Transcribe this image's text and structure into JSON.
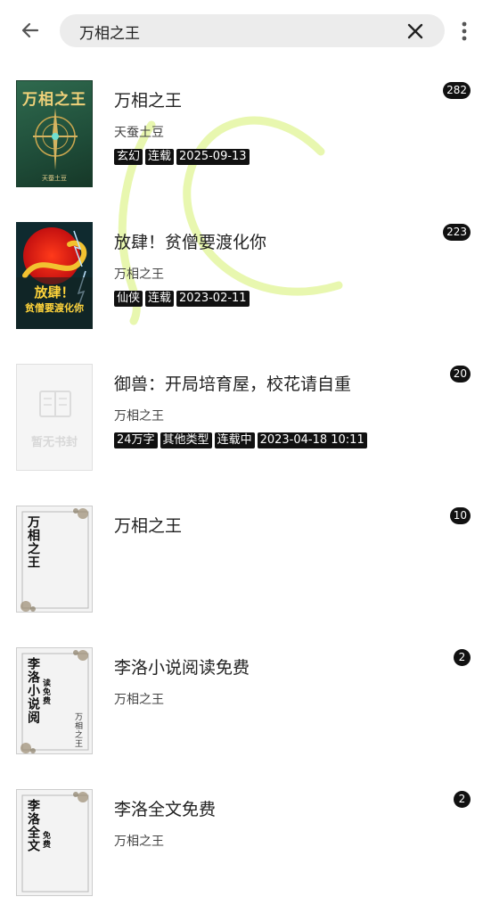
{
  "search": {
    "query": "万相之王"
  },
  "icons": {
    "back": "arrow-left-icon",
    "clear": "close-icon",
    "more": "more-vert-icon"
  },
  "books": [
    {
      "title": "万相之王",
      "author": "天蚕土豆",
      "tags": [
        "玄幻",
        "连载",
        "2025-09-13"
      ],
      "badge": "282",
      "cover": {
        "type": "green",
        "title": "万相之王",
        "author": "天蚕土豆"
      }
    },
    {
      "title": "放肆！贫僧要渡化你",
      "author": "万相之王",
      "tags": [
        "仙侠",
        "连载",
        "2023-02-11"
      ],
      "badge": "223",
      "cover": {
        "type": "dragon",
        "title_line1": "放肆！",
        "title_line2": "贫僧要渡化你"
      }
    },
    {
      "title": "御兽：开局培育屋，校花请自重",
      "author": "万相之王",
      "tags": [
        "24万字",
        "其他类型",
        "连载中",
        "2023-04-18 10:11"
      ],
      "badge": "20",
      "cover": {
        "type": "empty",
        "text": "暂无书封"
      }
    },
    {
      "title": "万相之王",
      "author": "",
      "tags": [],
      "badge": "10",
      "cover": {
        "type": "frame",
        "title": "万相之王"
      }
    },
    {
      "title": "李洛小说阅读免费",
      "author": "万相之王",
      "tags": [],
      "badge": "2",
      "cover": {
        "type": "frame",
        "title": "李洛小说阅",
        "subtitle": "读免费",
        "author": "万相之王"
      }
    },
    {
      "title": "李洛全文免费",
      "author": "万相之王",
      "tags": [],
      "badge": "2",
      "cover": {
        "type": "frame",
        "title": "李洛全文",
        "subtitle": "免费"
      }
    }
  ]
}
